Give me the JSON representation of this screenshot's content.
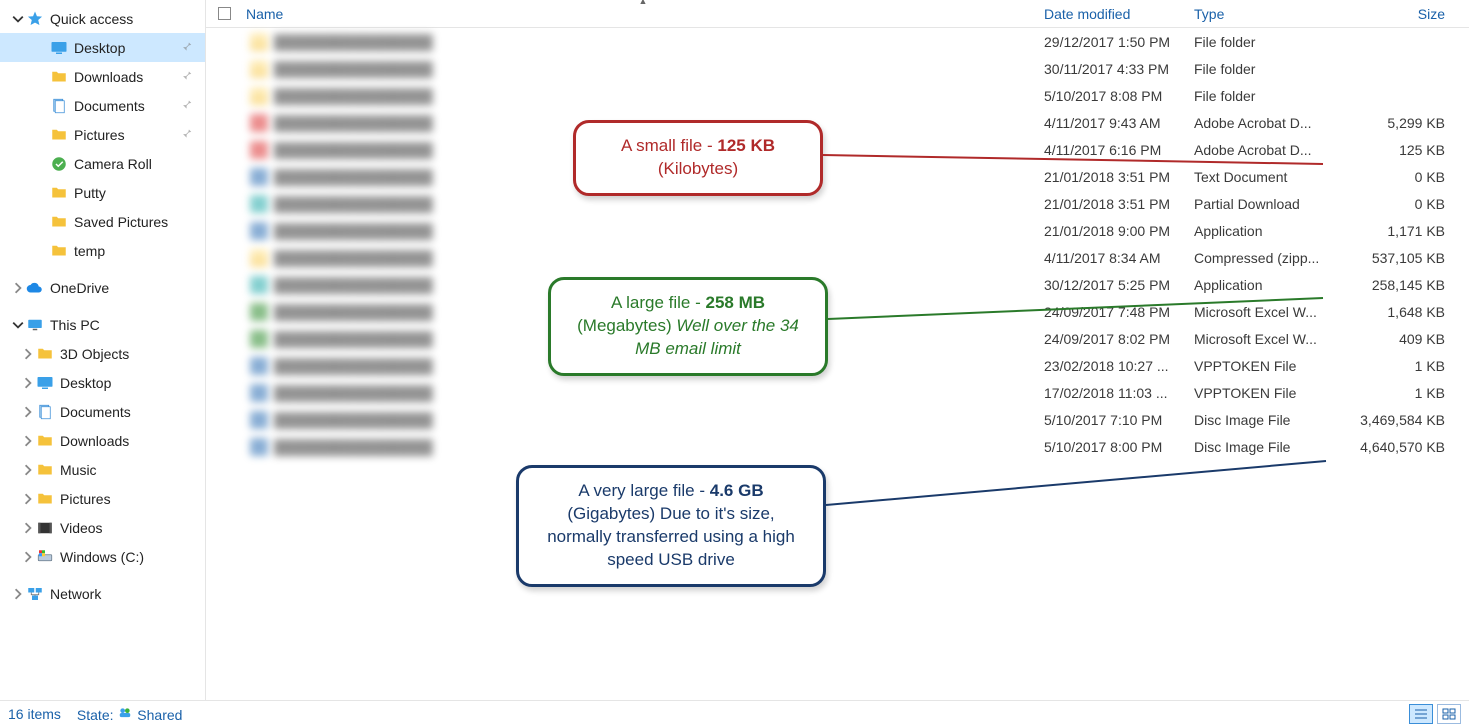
{
  "columns": {
    "name": "Name",
    "date": "Date modified",
    "type": "Type",
    "size": "Size"
  },
  "sidebar": {
    "quickaccess": {
      "label": "Quick access",
      "items": [
        {
          "label": "Desktop",
          "pinned": true,
          "selected": true
        },
        {
          "label": "Downloads",
          "pinned": true
        },
        {
          "label": "Documents",
          "pinned": true
        },
        {
          "label": "Pictures",
          "pinned": true
        },
        {
          "label": "Camera Roll"
        },
        {
          "label": "Putty"
        },
        {
          "label": "Saved Pictures"
        },
        {
          "label": "temp"
        }
      ]
    },
    "onedrive": {
      "label": "OneDrive"
    },
    "thispc": {
      "label": "This PC",
      "items": [
        {
          "label": "3D Objects"
        },
        {
          "label": "Desktop"
        },
        {
          "label": "Documents"
        },
        {
          "label": "Downloads"
        },
        {
          "label": "Music"
        },
        {
          "label": "Pictures"
        },
        {
          "label": "Videos"
        },
        {
          "label": "Windows (C:)"
        }
      ]
    },
    "network": {
      "label": "Network"
    }
  },
  "rows": [
    {
      "date": "29/12/2017 1:50 PM",
      "type": "File folder",
      "size": ""
    },
    {
      "date": "30/11/2017 4:33 PM",
      "type": "File folder",
      "size": ""
    },
    {
      "date": "5/10/2017 8:08 PM",
      "type": "File folder",
      "size": ""
    },
    {
      "date": "4/11/2017 9:43 AM",
      "type": "Adobe Acrobat D...",
      "size": "5,299 KB"
    },
    {
      "date": "4/11/2017 6:16 PM",
      "type": "Adobe Acrobat D...",
      "size": "125 KB"
    },
    {
      "date": "21/01/2018 3:51 PM",
      "type": "Text Document",
      "size": "0 KB"
    },
    {
      "date": "21/01/2018 3:51 PM",
      "type": "Partial Download",
      "size": "0 KB"
    },
    {
      "date": "21/01/2018 9:00 PM",
      "type": "Application",
      "size": "1,171 KB"
    },
    {
      "date": "4/11/2017 8:34 AM",
      "type": "Compressed (zipp...",
      "size": "537,105 KB"
    },
    {
      "date": "30/12/2017 5:25 PM",
      "type": "Application",
      "size": "258,145 KB"
    },
    {
      "date": "24/09/2017 7:48 PM",
      "type": "Microsoft Excel W...",
      "size": "1,648 KB"
    },
    {
      "date": "24/09/2017 8:02 PM",
      "type": "Microsoft Excel W...",
      "size": "409 KB"
    },
    {
      "date": "23/02/2018 10:27 ...",
      "type": "VPPTOKEN File",
      "size": "1 KB"
    },
    {
      "date": "17/02/2018 11:03 ...",
      "type": "VPPTOKEN File",
      "size": "1 KB"
    },
    {
      "date": "5/10/2017 7:10 PM",
      "type": "Disc Image File",
      "size": "3,469,584 KB"
    },
    {
      "date": "5/10/2017 8:00 PM",
      "type": "Disc Image File",
      "size": "4,640,570 KB"
    }
  ],
  "callouts": {
    "red": {
      "t1": "A small file - ",
      "b": "125 KB",
      "t2": "(Kilobytes)"
    },
    "green": {
      "t1": "A large file - ",
      "b": "258 MB",
      "t2": "(Megabytes) ",
      "i": "Well over the 34 MB email limit"
    },
    "navy": {
      "t1": "A very large file - ",
      "b": "4.6 GB",
      "t2": "(Gigabytes) Due to it's size, normally transferred using a high speed USB drive"
    }
  },
  "statusbar": {
    "items": "16 items",
    "state_label": "State:",
    "state_value": "Shared"
  }
}
